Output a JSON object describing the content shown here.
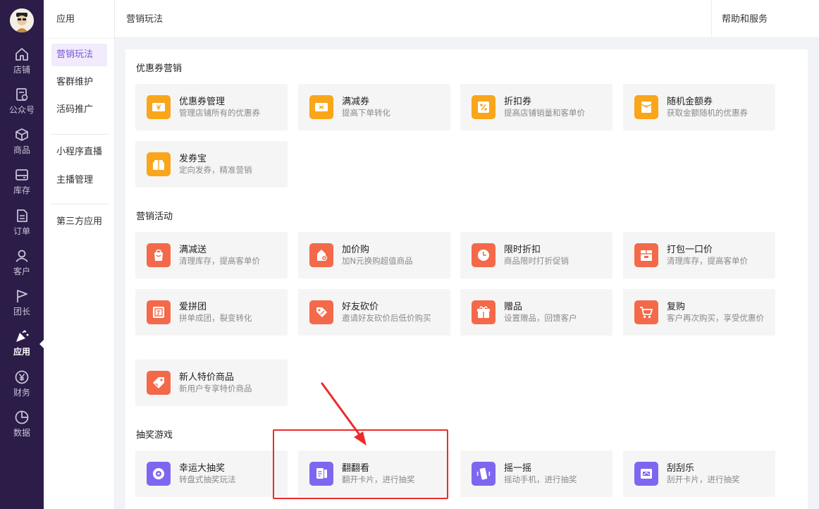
{
  "nav": [
    {
      "label": "店铺",
      "icon": "home-icon"
    },
    {
      "label": "公众号",
      "icon": "document-gear-icon"
    },
    {
      "label": "商品",
      "icon": "box-icon"
    },
    {
      "label": "库存",
      "icon": "inbox-icon"
    },
    {
      "label": "订单",
      "icon": "list-icon"
    },
    {
      "label": "客户",
      "icon": "users-icon"
    },
    {
      "label": "团长",
      "icon": "flag-icon"
    },
    {
      "label": "应用",
      "icon": "party-icon"
    },
    {
      "label": "财务",
      "icon": "yen-icon"
    },
    {
      "label": "数据",
      "icon": "pie-chart-icon"
    }
  ],
  "subnav": {
    "title": "应用",
    "items": [
      "营销玩法",
      "客群维护",
      "活码推广",
      "小程序直播",
      "主播管理",
      "第三方应用"
    ]
  },
  "header": {
    "title": "营销玩法",
    "help": "帮助和服务"
  },
  "sections": [
    {
      "title": "优惠券营销",
      "cards": [
        {
          "title": "优惠券管理",
          "desc": "管理店铺所有的优惠券"
        },
        {
          "title": "满减券",
          "desc": "提高下单转化"
        },
        {
          "title": "折扣券",
          "desc": "提高店铺销量和客单价"
        },
        {
          "title": "随机金额券",
          "desc": "获取金额随机的优惠券"
        },
        {
          "title": "发券宝",
          "desc": "定向发券，精准营销"
        }
      ]
    },
    {
      "title": "营销活动",
      "cards": [
        {
          "title": "满减送",
          "desc": "清理库存，提高客单价"
        },
        {
          "title": "加价购",
          "desc": "加N元换购超值商品"
        },
        {
          "title": "限时折扣",
          "desc": "商品限时打折促销"
        },
        {
          "title": "打包一口价",
          "desc": "清理库存，提高客单价"
        },
        {
          "title": "爱拼团",
          "desc": "拼单成团，裂变转化"
        },
        {
          "title": "好友砍价",
          "desc": "邀请好友砍价后低价购买"
        },
        {
          "title": "赠品",
          "desc": "设置赠品，回馈客户"
        },
        {
          "title": "复购",
          "desc": "客户再次购买，享受优惠价"
        },
        {
          "title": "新人特价商品",
          "desc": "新用户专享特价商品"
        }
      ]
    },
    {
      "title": "抽奖游戏",
      "cards": [
        {
          "title": "幸运大抽奖",
          "desc": "转盘式抽奖玩法"
        },
        {
          "title": "翻翻看",
          "desc": "翻开卡片，进行抽奖"
        },
        {
          "title": "摇一摇",
          "desc": "摇动手机，进行抽奖"
        },
        {
          "title": "刮刮乐",
          "desc": "刮开卡片，进行抽奖"
        }
      ]
    }
  ],
  "colors": {
    "nav_bg": "#2b1d47",
    "accent": "#7a55d8",
    "coupon_icon": "#f9a61b",
    "activity_icon": "#f4694a",
    "lottery_icon": "#7f66f0",
    "highlight": "#ec2b2b"
  }
}
